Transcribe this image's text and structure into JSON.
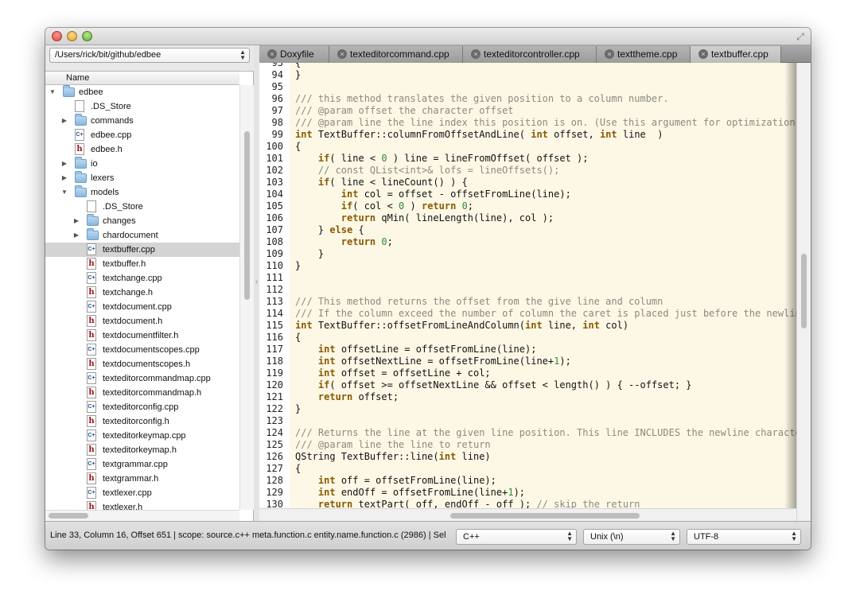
{
  "sidebar": {
    "path": "/Users/rick/bit/github/edbee",
    "column_header": "Name",
    "tree": [
      {
        "label": "edbee",
        "type": "folder",
        "level": 1,
        "expanded": true
      },
      {
        "label": ".DS_Store",
        "type": "file",
        "level": 2
      },
      {
        "label": "commands",
        "type": "folder",
        "level": 2,
        "expanded": false
      },
      {
        "label": "edbee.cpp",
        "type": "cpp",
        "level": 2
      },
      {
        "label": "edbee.h",
        "type": "h",
        "level": 2
      },
      {
        "label": "io",
        "type": "folder",
        "level": 2,
        "expanded": false
      },
      {
        "label": "lexers",
        "type": "folder",
        "level": 2,
        "expanded": false
      },
      {
        "label": "models",
        "type": "folder",
        "level": 2,
        "expanded": true
      },
      {
        "label": ".DS_Store",
        "type": "file",
        "level": 3
      },
      {
        "label": "changes",
        "type": "folder",
        "level": 3,
        "expanded": false
      },
      {
        "label": "chardocument",
        "type": "folder",
        "level": 3,
        "expanded": false
      },
      {
        "label": "textbuffer.cpp",
        "type": "cpp",
        "level": 3,
        "selected": true
      },
      {
        "label": "textbuffer.h",
        "type": "h",
        "level": 3
      },
      {
        "label": "textchange.cpp",
        "type": "cpp",
        "level": 3
      },
      {
        "label": "textchange.h",
        "type": "h",
        "level": 3
      },
      {
        "label": "textdocument.cpp",
        "type": "cpp",
        "level": 3
      },
      {
        "label": "textdocument.h",
        "type": "h",
        "level": 3
      },
      {
        "label": "textdocumentfilter.h",
        "type": "h",
        "level": 3
      },
      {
        "label": "textdocumentscopes.cpp",
        "type": "cpp",
        "level": 3
      },
      {
        "label": "textdocumentscopes.h",
        "type": "h",
        "level": 3
      },
      {
        "label": "texteditorcommandmap.cpp",
        "type": "cpp",
        "level": 3
      },
      {
        "label": "texteditorcommandmap.h",
        "type": "h",
        "level": 3
      },
      {
        "label": "texteditorconfig.cpp",
        "type": "cpp",
        "level": 3
      },
      {
        "label": "texteditorconfig.h",
        "type": "h",
        "level": 3
      },
      {
        "label": "texteditorkeymap.cpp",
        "type": "cpp",
        "level": 3
      },
      {
        "label": "texteditorkeymap.h",
        "type": "h",
        "level": 3
      },
      {
        "label": "textgrammar.cpp",
        "type": "cpp",
        "level": 3
      },
      {
        "label": "textgrammar.h",
        "type": "h",
        "level": 3
      },
      {
        "label": "textlexer.cpp",
        "type": "cpp",
        "level": 3
      },
      {
        "label": "textlexer.h",
        "type": "h",
        "level": 3
      }
    ]
  },
  "tabs": [
    {
      "label": "Doxyfile",
      "active": false
    },
    {
      "label": "texteditorcommand.cpp",
      "active": false
    },
    {
      "label": "texteditorcontroller.cpp",
      "active": false
    },
    {
      "label": "texttheme.cpp",
      "active": false
    },
    {
      "label": "textbuffer.cpp",
      "active": true
    }
  ],
  "editor": {
    "lines": [
      {
        "n": "93",
        "code": "{"
      },
      {
        "n": "94",
        "code": "}"
      },
      {
        "n": "95",
        "code": ""
      },
      {
        "n": "96",
        "code": "/// this method translates the given position to a column number."
      },
      {
        "n": "97",
        "code": "/// @param offset the character offset"
      },
      {
        "n": "98",
        "code": "/// @param line the line index this position is on. (Use this argument for optimization"
      },
      {
        "n": "99",
        "code": "int TextBuffer::columnFromOffsetAndLine( int offset, int line  )"
      },
      {
        "n": "100",
        "code": "{"
      },
      {
        "n": "101",
        "code": "    if( line < 0 ) line = lineFromOffset( offset );"
      },
      {
        "n": "102",
        "code": "    // const QList<int>& lofs = lineOffsets();"
      },
      {
        "n": "103",
        "code": "    if( line < lineCount() ) {"
      },
      {
        "n": "104",
        "code": "        int col = offset - offsetFromLine(line);"
      },
      {
        "n": "105",
        "code": "        if( col < 0 ) return 0;"
      },
      {
        "n": "106",
        "code": "        return qMin( lineLength(line), col );"
      },
      {
        "n": "107",
        "code": "    } else {"
      },
      {
        "n": "108",
        "code": "        return 0;"
      },
      {
        "n": "109",
        "code": "    }"
      },
      {
        "n": "110",
        "code": "}"
      },
      {
        "n": "111",
        "code": ""
      },
      {
        "n": "112",
        "code": ""
      },
      {
        "n": "113",
        "code": "/// This method returns the offset from the give line and column"
      },
      {
        "n": "114",
        "code": "/// If the column exceed the number of column the caret is placed just before the newlin"
      },
      {
        "n": "115",
        "code": "int TextBuffer::offsetFromLineAndColumn(int line, int col)"
      },
      {
        "n": "116",
        "code": "{"
      },
      {
        "n": "117",
        "code": "    int offsetLine = offsetFromLine(line);"
      },
      {
        "n": "118",
        "code": "    int offsetNextLine = offsetFromLine(line+1);"
      },
      {
        "n": "119",
        "code": "    int offset = offsetLine + col;"
      },
      {
        "n": "120",
        "code": "    if( offset >= offsetNextLine && offset < length() ) { --offset; }"
      },
      {
        "n": "121",
        "code": "    return offset;"
      },
      {
        "n": "122",
        "code": "}"
      },
      {
        "n": "123",
        "code": ""
      },
      {
        "n": "124",
        "code": "/// Returns the line at the given line position. This line INCLUDES the newline characte"
      },
      {
        "n": "125",
        "code": "/// @param line the line to return"
      },
      {
        "n": "126",
        "code": "QString TextBuffer::line(int line)"
      },
      {
        "n": "127",
        "code": "{"
      },
      {
        "n": "128",
        "code": "    int off = offsetFromLine(line);"
      },
      {
        "n": "129",
        "code": "    int endOff = offsetFromLine(line+1);"
      },
      {
        "n": "130",
        "code": "    return textPart( off, endOff - off ); // skip the return"
      }
    ]
  },
  "status": {
    "text": "Line 33, Column 16, Offset 651 | scope: source.c++ meta.function.c entity.name.function.c  (2986) | Sel",
    "language": "C++",
    "line_ending": "Unix (\\n)",
    "encoding": "UTF-8"
  },
  "colors": {
    "code_background": "#fdf8e6",
    "comment": "#8a8a80",
    "keyword": "#8a5a00",
    "number": "#2d8a3a"
  }
}
